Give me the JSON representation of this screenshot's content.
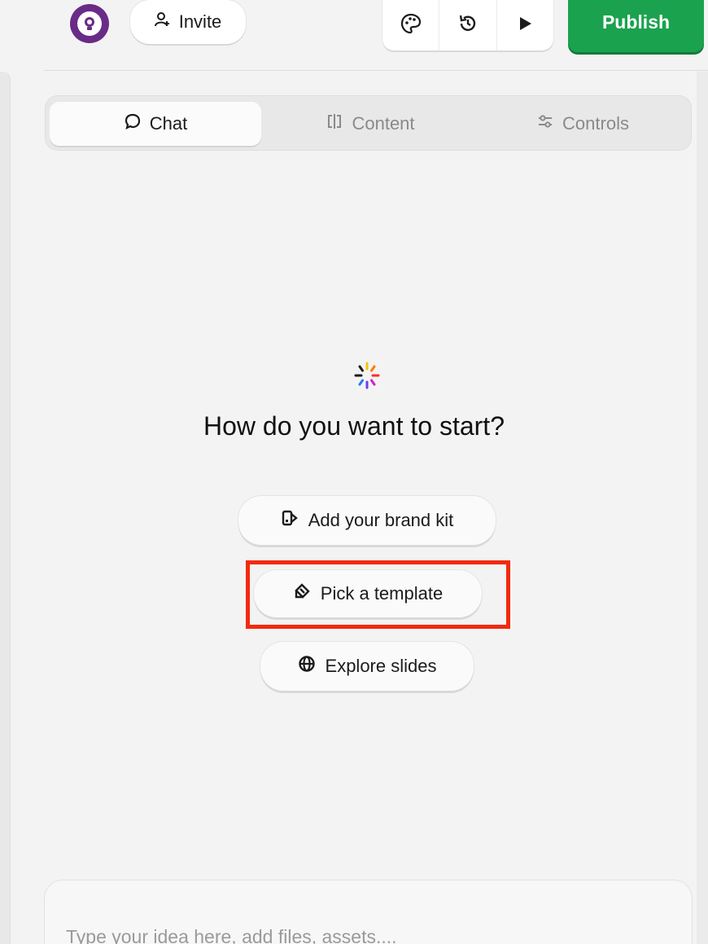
{
  "topbar": {
    "invite_label": "Invite",
    "publish_label": "Publish",
    "tools": [
      "palette-icon",
      "history-icon",
      "play-icon"
    ]
  },
  "tabs": [
    {
      "label": "Chat",
      "icon": "chat-bubble-icon",
      "active": true
    },
    {
      "label": "Content",
      "icon": "content-icon",
      "active": false
    },
    {
      "label": "Controls",
      "icon": "sliders-icon",
      "active": false
    }
  ],
  "main": {
    "heading": "How do you want to start?",
    "actions": [
      {
        "label": "Add your brand kit",
        "icon": "brand-kit-icon"
      },
      {
        "label": "Pick a template",
        "icon": "template-icon"
      },
      {
        "label": "Explore slides",
        "icon": "globe-icon"
      }
    ]
  },
  "composer": {
    "placeholder": "Type your idea here, add files, assets...."
  },
  "colors": {
    "publish": "#1aa24e",
    "highlight": "#f22a0e",
    "avatar": "#6a2b87"
  }
}
